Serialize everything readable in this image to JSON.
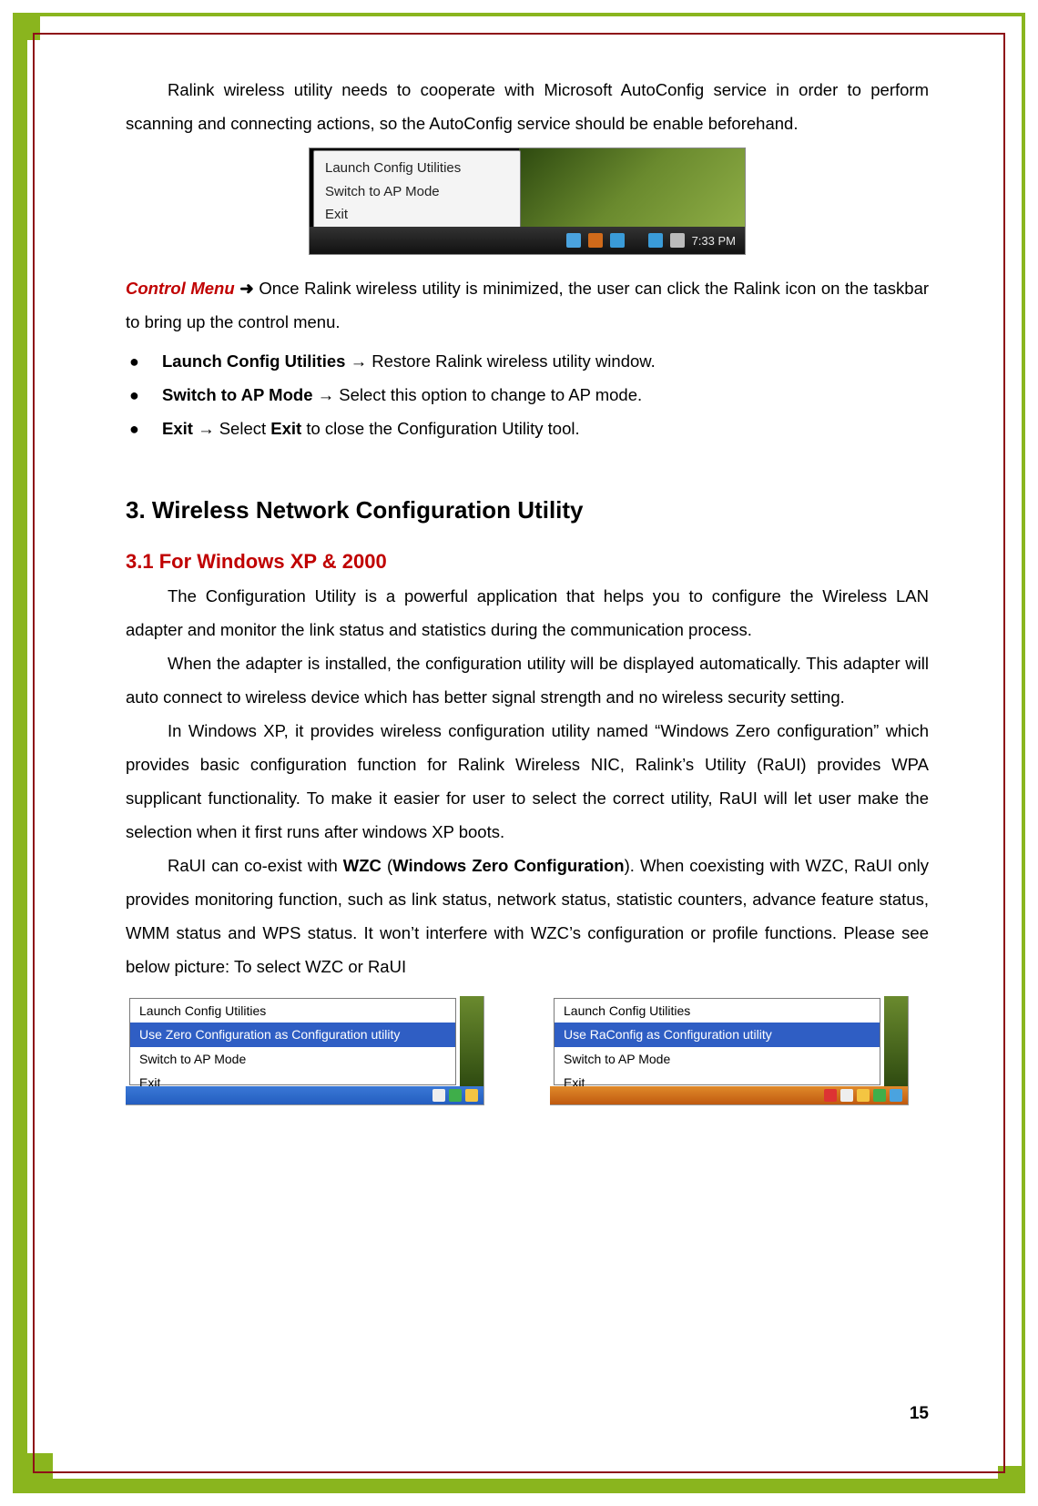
{
  "intro_para": "Ralink wireless utility needs to cooperate with Microsoft AutoConfig service in order to perform scanning and connecting actions, so the AutoConfig service should be enable beforehand.",
  "vista_menu": {
    "items": [
      "Launch Config Utilities",
      "Switch to AP Mode",
      "Exit"
    ],
    "clock": "7:33 PM"
  },
  "control_menu": {
    "title": "Control Menu",
    "arrow": "➜",
    "desc": " Once Ralink wireless utility is minimized, the user can click the Ralink icon on the taskbar to bring up the control menu."
  },
  "bullets": [
    {
      "label": "Launch Config Utilities",
      "arrow": "→",
      "rest": " Restore Ralink wireless utility window."
    },
    {
      "label": "Switch to AP Mode",
      "arrow": "→",
      "rest": " Select this option to change to AP mode."
    },
    {
      "label": "Exit",
      "arrow": "→",
      "rest_pre": " Select ",
      "rest_bold": "Exit",
      "rest_post": " to close the Configuration Utility tool."
    }
  ],
  "section_heading": "3.  Wireless Network Configuration Utility",
  "sub_heading": "3.1 For Windows XP & 2000",
  "paras": [
    "The Configuration Utility is a powerful application that helps you to configure the Wireless LAN adapter and monitor the link status and statistics during the communication process.",
    "When the adapter is installed, the configuration utility will be displayed automatically. This adapter will auto connect to wireless device which has better signal strength and no wireless security setting.",
    "In Windows XP, it provides wireless configuration utility named “Windows Zero configuration” which provides basic configuration function for Ralink Wireless NIC, Ralink’s Utility (RaUI) provides WPA supplicant functionality. To make it easier for user to select the correct utility, RaUI will let user make the selection when it first runs after windows XP boots."
  ],
  "wzc_para": {
    "pre": "RaUI can co-exist with ",
    "b1": "WZC",
    "mid1": " (",
    "b2": "Windows Zero Configuration",
    "post": "). When coexisting with WZC, RaUI only provides monitoring function, such as link status, network status, statistic counters, advance feature status, WMM status and WPS status. It won’t interfere with WZC’s configuration or profile functions. Please see below picture: To select WZC or RaUI"
  },
  "xp_left": {
    "items": [
      "Launch Config Utilities",
      "Use Zero Configuration as Configuration utility",
      "Switch to AP Mode",
      "Exit"
    ],
    "selected_index": 1
  },
  "xp_right": {
    "items": [
      "Launch Config Utilities",
      "Use RaConfig as Configuration utility",
      "Switch to AP Mode",
      "Exit"
    ],
    "selected_index": 1
  },
  "page_number": "15"
}
